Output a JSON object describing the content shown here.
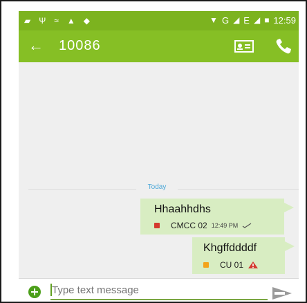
{
  "status_bar": {
    "time": "12:59",
    "network": "G",
    "network2": "E"
  },
  "header": {
    "back_icon": "arrow-left-icon",
    "title": "10086",
    "contact_icon": "contact-card-icon",
    "call_icon": "phone-icon"
  },
  "conversation": {
    "date_separator": "Today",
    "messages": [
      {
        "text": "Hhaahhdhs",
        "sim": "CMCC 02",
        "time": "12:49 PM",
        "status_icon": "checkmark-icon"
      },
      {
        "text": "Khgffddddf",
        "sim": "CU 01",
        "time": "",
        "status_icon": "warning-icon"
      }
    ]
  },
  "composer": {
    "add_icon": "add-icon",
    "placeholder": "Type text message",
    "send_icon": "send-icon"
  },
  "colors": {
    "accent": "#86bf25",
    "status_bar": "#7cb31f",
    "bubble": "#d8edc2",
    "date_label": "#4aa7d8",
    "warning": "#d43a2f",
    "sim2": "#f3a31b"
  }
}
